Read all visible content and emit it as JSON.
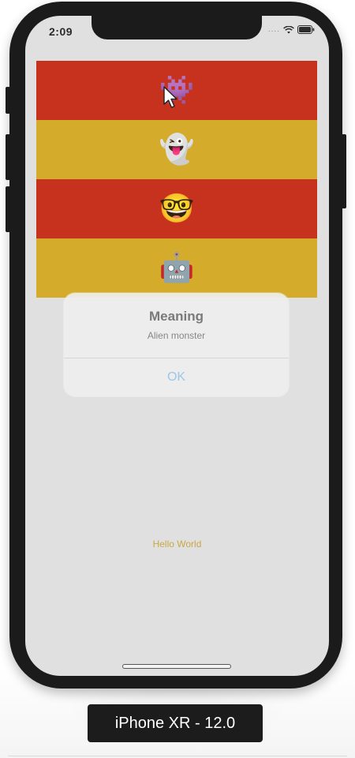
{
  "status_bar": {
    "time": "2:09",
    "signal_dots": "....",
    "wifi_icon": "wifi-icon",
    "battery_icon": "battery-icon"
  },
  "emoji_list": {
    "rows": [
      {
        "emoji": "👾",
        "icon": "alien-monster-icon",
        "color": "#c7321f"
      },
      {
        "emoji": "👻",
        "icon": "ghost-icon",
        "color": "#d4ab2a"
      },
      {
        "emoji": "🤓",
        "icon": "nerd-face-icon",
        "color": "#c7321f"
      },
      {
        "emoji": "🤖",
        "icon": "robot-icon",
        "color": "#d4ab2a"
      }
    ]
  },
  "alert": {
    "title": "Meaning",
    "message": "Alien monster",
    "ok_label": "OK"
  },
  "main": {
    "hello_label": "Hello World"
  },
  "device": {
    "label": "iPhone XR - 12.0"
  },
  "colors": {
    "red": "#c7321f",
    "yellow": "#d4ab2a",
    "accent_blue": "#9dc6e8",
    "hello_text": "#c9a845"
  }
}
